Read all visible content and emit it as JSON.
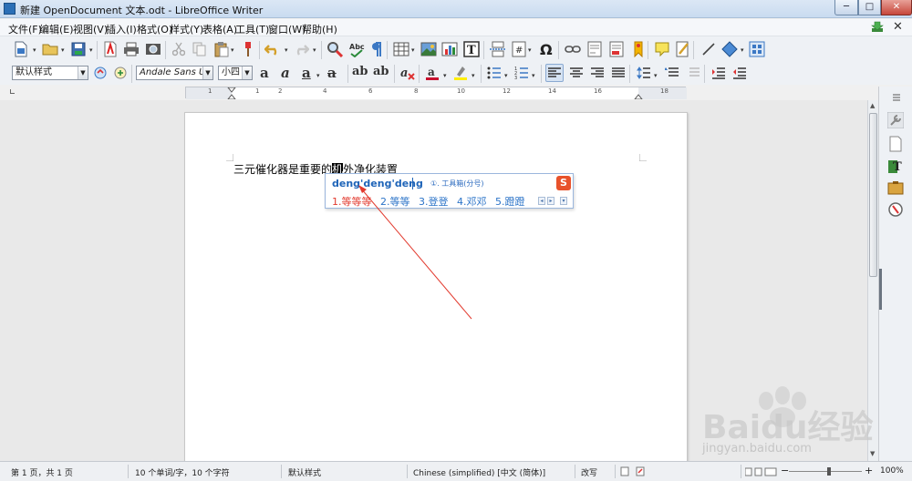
{
  "window": {
    "title": "新建 OpenDocument 文本.odt - LibreOffice Writer",
    "minimize": "─",
    "maximize": "□",
    "close": "✕"
  },
  "menu": {
    "items": [
      "文件(F)",
      "编辑(E)",
      "视图(V)",
      "插入(I)",
      "格式(O)",
      "样式(Y)",
      "表格(A)",
      "工具(T)",
      "窗口(W)",
      "帮助(H)"
    ],
    "close_document": "✕"
  },
  "format_toolbar": {
    "paragraph_style": "默认样式",
    "font_name": "Andale Sans UI",
    "font_size": "小四"
  },
  "ruler": {
    "ticks": [
      "1",
      "1",
      "2",
      "4",
      "6",
      "8",
      "10",
      "12",
      "14",
      "16",
      "18"
    ]
  },
  "document": {
    "text_before": "三元催化器是重要的",
    "text_selected": "机",
    "text_after": "外净化装置"
  },
  "ime": {
    "pinyin": "deng'deng'deng",
    "hint": "①. 工具箱(分号)",
    "logo": "S",
    "candidates": [
      "1.等等等",
      "2.等等",
      "3.登登",
      "4.邓邓",
      "5.蹬蹬"
    ],
    "prev": "◂",
    "next": "▸",
    "more": "▾"
  },
  "statusbar": {
    "page": "第 1 页，共 1 页",
    "words": "10 个单词/字，10 个字符",
    "page_style": "默认样式",
    "language": "Chinese (simplified) [中文 (简体)]",
    "mode": "改写",
    "zoom": "100%"
  },
  "watermark": {
    "brand": "Baidu经验",
    "url": "jingyan.baidu.com"
  },
  "colors": {
    "accent": "#1e64b8",
    "annotation": "#e23a2e"
  }
}
